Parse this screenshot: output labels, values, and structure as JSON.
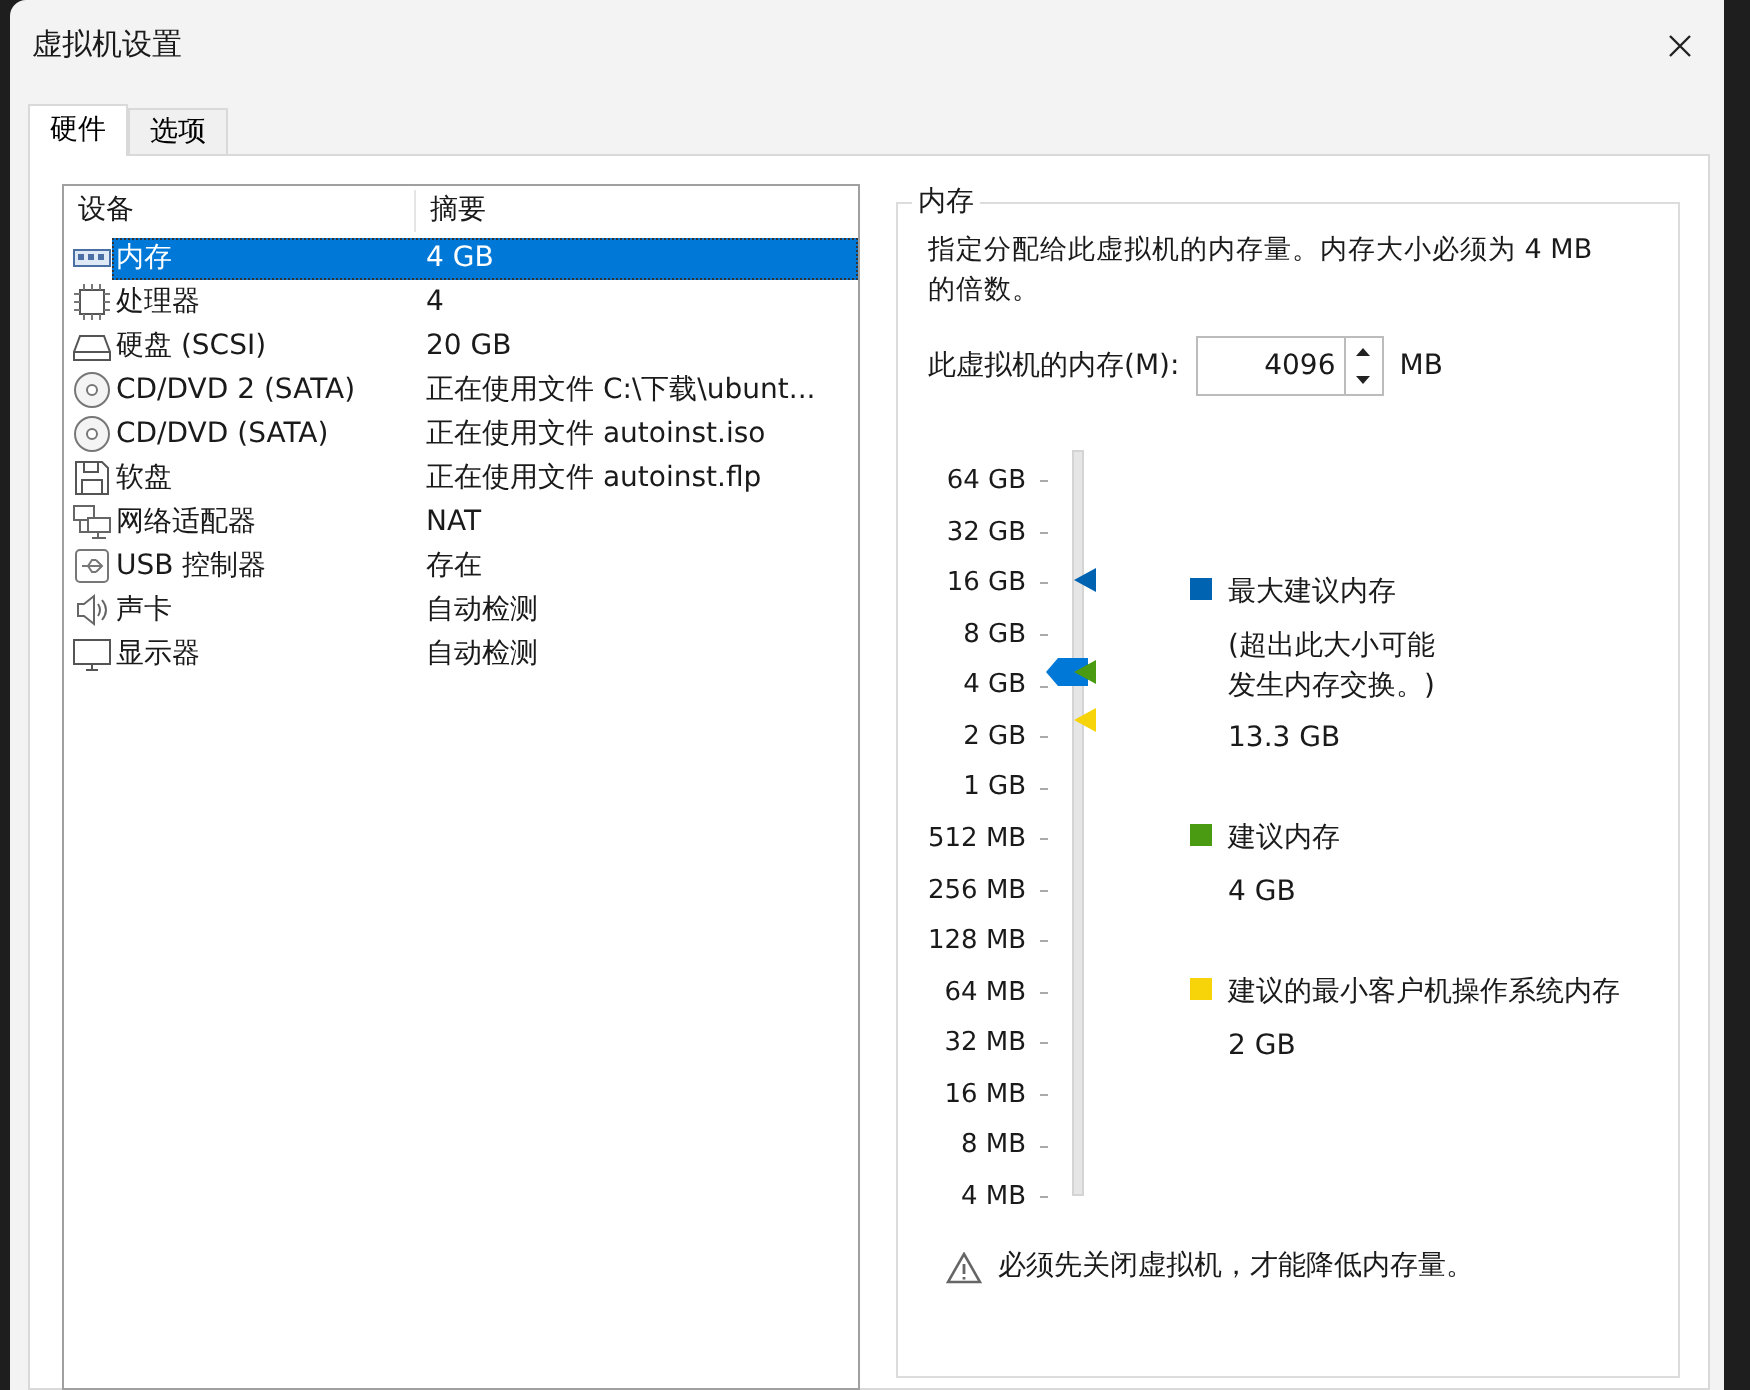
{
  "window": {
    "title": "虚拟机设置"
  },
  "tabs": [
    {
      "label": "硬件",
      "selected": true
    },
    {
      "label": "选项",
      "selected": false
    }
  ],
  "device_list": {
    "columns": [
      "设备",
      "摘要"
    ],
    "rows": [
      {
        "kind": "memory",
        "device": "内存",
        "summary": "4 GB",
        "selected": true
      },
      {
        "kind": "cpu",
        "device": "处理器",
        "summary": "4",
        "selected": false
      },
      {
        "kind": "disk",
        "device": "硬盘 (SCSI)",
        "summary": "20 GB",
        "selected": false
      },
      {
        "kind": "cdrom",
        "device": "CD/DVD 2 (SATA)",
        "summary": "正在使用文件 C:\\下载\\ubunt...",
        "selected": false
      },
      {
        "kind": "cdrom",
        "device": "CD/DVD (SATA)",
        "summary": "正在使用文件 autoinst.iso",
        "selected": false
      },
      {
        "kind": "floppy",
        "device": "软盘",
        "summary": "正在使用文件 autoinst.flp",
        "selected": false
      },
      {
        "kind": "network",
        "device": "网络适配器",
        "summary": "NAT",
        "selected": false
      },
      {
        "kind": "usb",
        "device": "USB 控制器",
        "summary": "存在",
        "selected": false
      },
      {
        "kind": "sound",
        "device": "声卡",
        "summary": "自动检测",
        "selected": false
      },
      {
        "kind": "display",
        "device": "显示器",
        "summary": "自动检测",
        "selected": false
      }
    ]
  },
  "memory_group": {
    "title": "内存",
    "description": "指定分配给此虚拟机的内存量。内存大小必须为 4 MB 的倍数。",
    "field_label": "此虚拟机的内存(M):",
    "value": "4096",
    "unit": "MB",
    "slider": {
      "ticks": [
        "64 GB",
        "32 GB",
        "16 GB",
        "8 GB",
        "4 GB",
        "2 GB",
        "1 GB",
        "512 MB",
        "256 MB",
        "128 MB",
        "64 MB",
        "32 MB",
        "16 MB",
        "8 MB",
        "4 MB"
      ],
      "level": 0.705,
      "markers": [
        {
          "color": "#0063b1",
          "level": 0.828
        },
        {
          "color": "#4a9a12",
          "level": 0.705
        },
        {
          "color": "#f7d40a",
          "level": 0.641
        }
      ]
    },
    "legend": [
      {
        "label": "最大建议内存",
        "note": "(超出此大小可能发生内存交换。)",
        "value": "13.3 GB",
        "color": "#0063b1"
      },
      {
        "label": "建议内存",
        "value": "4 GB",
        "color": "#4a9a12"
      },
      {
        "label": "建议的最小客户机操作系统内存",
        "value": "2 GB",
        "color": "#f7d40a"
      }
    ],
    "warning": "必须先关闭虚拟机，才能降低内存量。"
  }
}
